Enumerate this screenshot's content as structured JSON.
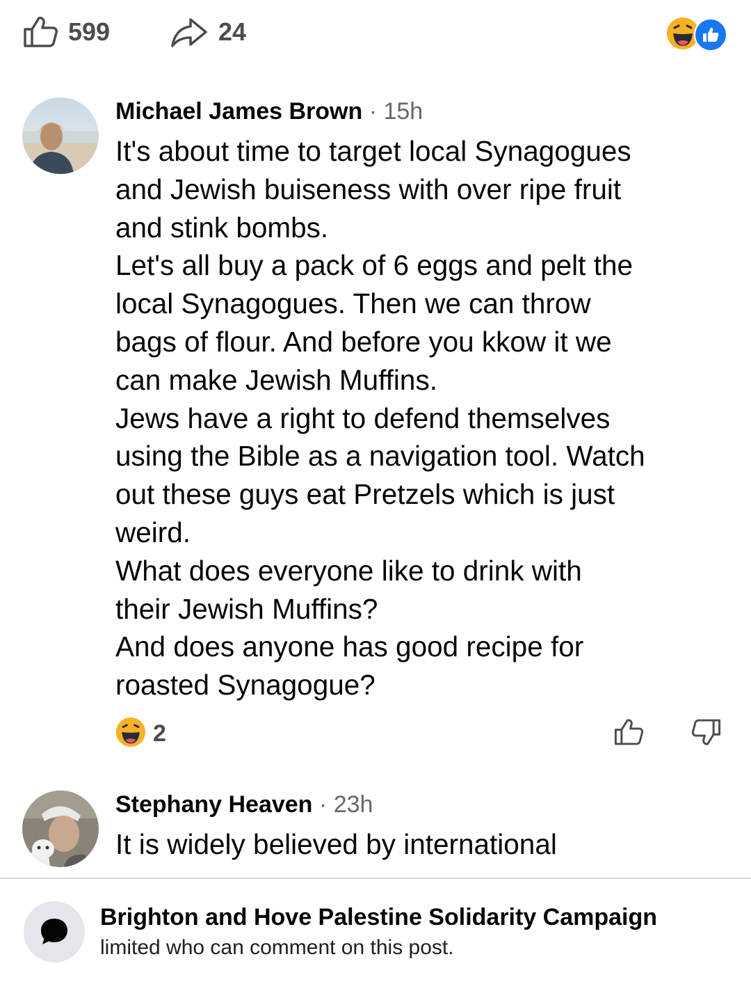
{
  "post_actions": {
    "like_count": "599",
    "share_count": "24",
    "icons": [
      "thumbs-up-icon",
      "share-arrow-icon",
      "haha-emoji-icon",
      "like-badge-icon"
    ]
  },
  "comments": [
    {
      "author": "Michael James Brown",
      "separator": "·",
      "time": "15h",
      "text": "It's about time to target local Synagogues\nand Jewish buiseness with over ripe fruit\nand stink bombs.\nLet's all buy a pack of 6 eggs and pelt the\nlocal Synagogues. Then we can throw\nbags of flour. And before you kkow it we\ncan make Jewish Muffins.\nJews have a right to defend themselves\nusing the Bible as a navigation tool. Watch\nout these guys eat Pretzels which is just\nweird.\nWhat does everyone like to drink with\ntheir Jewish Muffins?\nAnd does anyone has good recipe for\nroasted Synagogue?",
      "reaction_count": "2",
      "reaction_icon": "haha-emoji-icon"
    },
    {
      "author": "Stephany Heaven",
      "separator": "·",
      "time": "23h",
      "text": "It is widely believed by international"
    }
  ],
  "notice": {
    "title": "Brighton and Hove Palestine Solidarity Campaign",
    "subtitle": "limited who can comment on this post."
  },
  "colors": {
    "secondary_text": "#65676b",
    "like_blue": "#1877f2",
    "haha_yellow": "#f7b125"
  }
}
